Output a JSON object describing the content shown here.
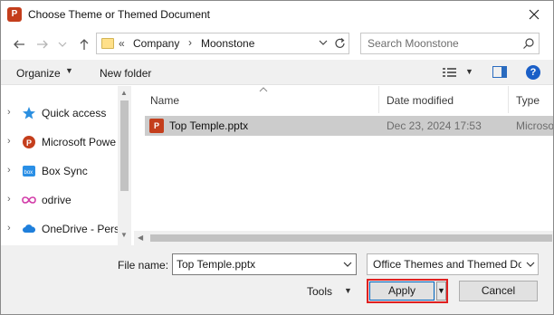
{
  "window": {
    "title": "Choose Theme or Themed Document",
    "app_icon": "powerpoint-icon"
  },
  "nav": {
    "back_icon": "arrow-left-icon",
    "forward_icon": "arrow-right-icon",
    "recent_icon": "chevron-down-icon",
    "up_icon": "arrow-up-icon",
    "address_overflow": "«",
    "crumbs": [
      "Company",
      "Moonstone"
    ],
    "search_placeholder": "Search Moonstone"
  },
  "toolbar": {
    "organize_label": "Organize",
    "new_folder_label": "New folder"
  },
  "sidebar": {
    "items": [
      {
        "label": "Quick access",
        "icon": "star-icon"
      },
      {
        "label": "Microsoft Powe",
        "icon": "powerpoint-icon"
      },
      {
        "label": "Box Sync",
        "icon": "box-icon"
      },
      {
        "label": "odrive",
        "icon": "infinity-icon"
      },
      {
        "label": "OneDrive - Pers",
        "icon": "cloud-icon"
      }
    ]
  },
  "files": {
    "columns": [
      "Name",
      "Date modified",
      "Type"
    ],
    "rows": [
      {
        "name": "Top Temple.pptx",
        "date": "Dec 23, 2024 17:53",
        "type": "Microso",
        "selected": true
      }
    ]
  },
  "footer": {
    "filename_label": "File name:",
    "filename_value": "Top Temple.pptx",
    "filetype_value": "Office Themes and Themed Do",
    "tools_label": "Tools",
    "apply_label": "Apply",
    "cancel_label": "Cancel"
  },
  "colors": {
    "accent": "#0067c0",
    "highlight_border": "#e02020",
    "selected_row": "#cccccc",
    "powerpoint": "#c43e1c"
  }
}
